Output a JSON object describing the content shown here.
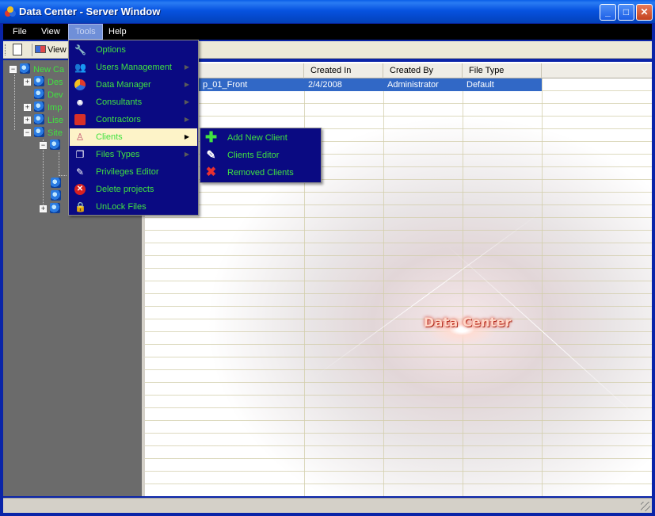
{
  "window": {
    "title": "Data Center - Server Window",
    "minimize": "_",
    "maximize": "□",
    "close": "✕"
  },
  "menubar": [
    "File",
    "View",
    "Tools",
    "Help"
  ],
  "toolbar": {
    "view_label": "View"
  },
  "tree": {
    "items": [
      "New Ca",
      "Des",
      "Dev",
      "Imp",
      "Lise",
      "Site"
    ]
  },
  "grid": {
    "columns": [
      "",
      "Created In",
      "Created By",
      "File Type"
    ],
    "rows": [
      {
        "name": "p_01_Front",
        "created_in": "2/4/2008",
        "created_by": "Administrator",
        "file_type": "Default"
      }
    ],
    "watermark": "Data Center"
  },
  "tools_menu": {
    "items": [
      {
        "label": "Options",
        "icon": "wrench-icon",
        "submenu": false
      },
      {
        "label": "Users Management",
        "icon": "users-icon",
        "submenu": true
      },
      {
        "label": "Data Manager",
        "icon": "pie-chart-icon",
        "submenu": true
      },
      {
        "label": "Consultants",
        "icon": "consultant-icon",
        "submenu": true
      },
      {
        "label": "Contractors",
        "icon": "toolbox-icon",
        "submenu": true
      },
      {
        "label": "Clients",
        "icon": "client-icon",
        "submenu": true
      },
      {
        "label": "Files Types",
        "icon": "files-icon",
        "submenu": true
      },
      {
        "label": "Privileges Editor",
        "icon": "privileges-icon",
        "submenu": false
      },
      {
        "label": "Delete projects",
        "icon": "delete-icon",
        "submenu": false
      },
      {
        "label": "UnLock Files",
        "icon": "lock-icon",
        "submenu": false
      }
    ]
  },
  "clients_submenu": {
    "items": [
      {
        "label": "Add New Client",
        "icon": "plus-icon"
      },
      {
        "label": "Clients Editor",
        "icon": "editor-icon"
      },
      {
        "label": "Removed Clients",
        "icon": "remove-icon"
      }
    ]
  },
  "colors": {
    "menu_bg": "#0a0a82",
    "menu_text": "#41e241",
    "selection": "#3168c6",
    "highlight": "#fdf3c8"
  }
}
